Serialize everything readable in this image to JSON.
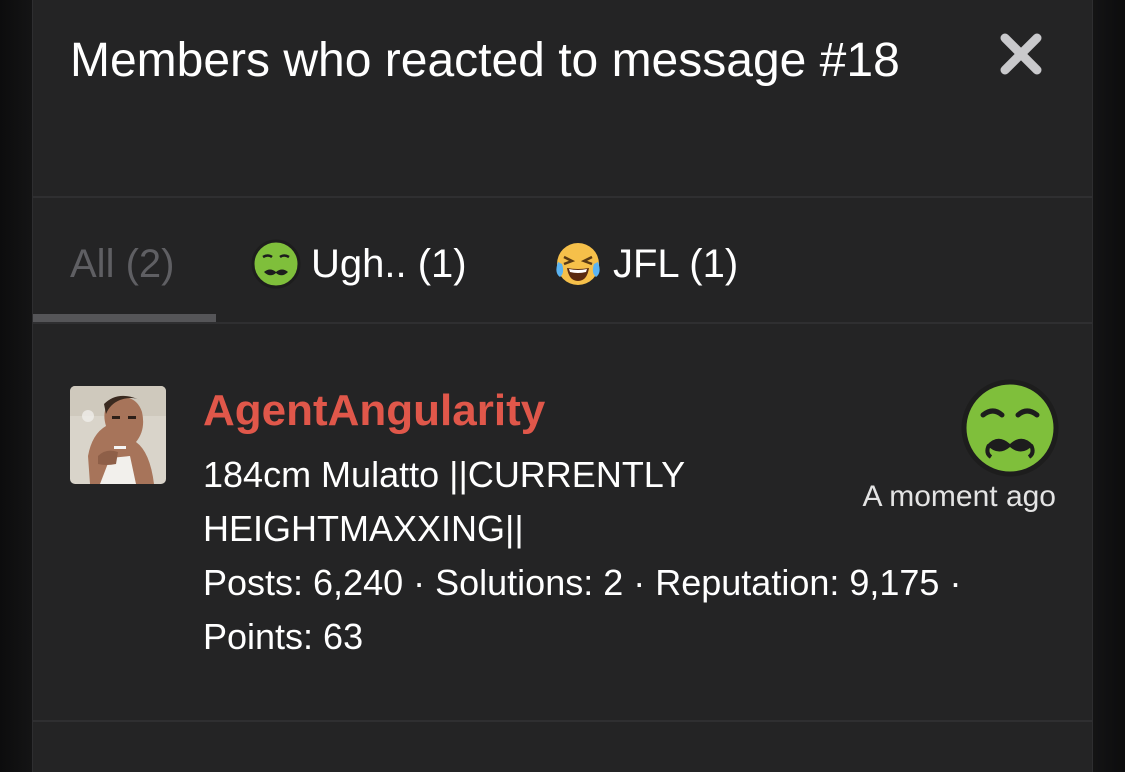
{
  "dialog": {
    "title": "Members who reacted to message #18",
    "close_icon": "close-icon"
  },
  "tabs": [
    {
      "label": "All (2)",
      "icon": null,
      "active": true
    },
    {
      "label": "Ugh.. (1)",
      "icon": "nauseated-face-icon",
      "active": false
    },
    {
      "label": "JFL (1)",
      "icon": "crying-laughing-face-icon",
      "active": false
    }
  ],
  "member": {
    "username": "AgentAngularity",
    "title": "184cm Mulatto ||CURRENTLY HEIGHTMAXXING||",
    "stats": "Posts: 6,240 · Solutions: 2 · Reputation: 9,175 · Points: 63",
    "time": "A moment ago",
    "reaction_icon": "nauseated-face-icon",
    "username_color": "#e0574a"
  },
  "colors": {
    "panel": "#242425",
    "divider": "#2f2f31",
    "active_tab_text": "#5f5f63",
    "text": "#ffffff"
  }
}
